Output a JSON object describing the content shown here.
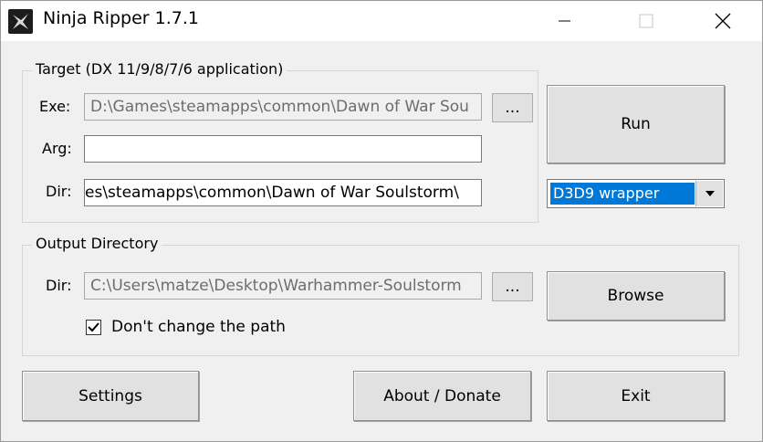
{
  "window": {
    "title": "Ninja Ripper 1.7.1"
  },
  "target": {
    "group_label": "Target (DX 11/9/8/7/6 application)",
    "exe_label": "Exe:",
    "exe_value": "D:\\Games\\steamapps\\common\\Dawn of War Sou",
    "arg_label": "Arg:",
    "arg_value": "",
    "dir_label": "Dir:",
    "dir_value": "es\\steamapps\\common\\Dawn of War Soulstorm\\",
    "browse_exe_label": "...",
    "run_label": "Run",
    "wrapper_selected": "D3D9 wrapper"
  },
  "output": {
    "group_label": "Output Directory",
    "dir_label": "Dir:",
    "dir_value": "C:\\Users\\matze\\Desktop\\Warhammer-Soulstorm",
    "browse_dir_label": "...",
    "browse_label": "Browse",
    "keep_path_label": "Don't change the path",
    "keep_path_checked": true
  },
  "footer": {
    "settings_label": "Settings",
    "about_label": "About / Donate",
    "exit_label": "Exit"
  },
  "icons": {
    "app": "ninja-star-icon",
    "minimize": "minimize-icon",
    "maximize": "maximize-icon",
    "close": "close-icon",
    "dropdown": "chevron-down-icon",
    "check": "check-icon"
  },
  "colors": {
    "selection": "#0078d7",
    "window_bg": "#f0f0f0"
  }
}
